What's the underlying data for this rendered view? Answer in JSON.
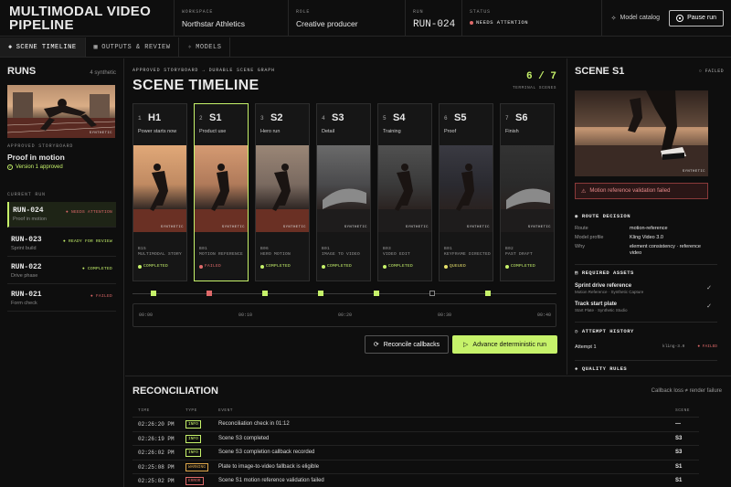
{
  "header": {
    "brand": "MULTIMODAL VIDEO PIPELINE",
    "workspace_label": "WORKSPACE",
    "workspace": "Northstar Athletics",
    "role_label": "ROLE",
    "role": "Creative producer",
    "run_label": "RUN",
    "run": "RUN-024",
    "status_label": "STATUS",
    "status": "NEEDS ATTENTION",
    "catalog": "Model catalog",
    "pause": "Pause run"
  },
  "tabs": [
    {
      "label": "SCENE TIMELINE",
      "icon": "layers-icon"
    },
    {
      "label": "OUTPUTS & REVIEW",
      "icon": "grid-icon"
    },
    {
      "label": "MODELS",
      "icon": "sparkle-icon"
    }
  ],
  "runs": {
    "title": "RUNS",
    "count": "4 synthetic",
    "thumb_tag": "SYNTHETIC",
    "storyboard_label": "APPROVED STORYBOARD",
    "storyboard_title": "Proof in motion",
    "storyboard_version": "Version 1 approved",
    "current_label": "CURRENT RUN",
    "items": [
      {
        "id": "RUN-024",
        "sub": "Proof in motion",
        "status": "NEEDS ATTENTION",
        "color": "#e06a6a"
      },
      {
        "id": "RUN-023",
        "sub": "Sprint build",
        "status": "READY FOR REVIEW",
        "color": "#c6f26a"
      },
      {
        "id": "RUN-022",
        "sub": "Drive phase",
        "status": "COMPLETED",
        "color": "#c6f26a"
      },
      {
        "id": "RUN-021",
        "sub": "Form check",
        "status": "FAILED",
        "color": "#e06a6a"
      }
    ]
  },
  "timeline": {
    "kicker": "APPROVED STORYBOARD → DURABLE SCENE GRAPH",
    "title": "SCENE TIMELINE",
    "count": "6 / 7",
    "count_label": "TERMINAL SCENES",
    "synthetic_tag": "SYNTHETIC",
    "scenes": [
      {
        "num": "1",
        "id": "H1",
        "name": "Power starts now",
        "code": "B15",
        "mode": "MULTIMODAL STORY",
        "status": "COMPLETED",
        "color": "#c6f26a"
      },
      {
        "num": "2",
        "id": "S1",
        "name": "Product use",
        "code": "B01",
        "mode": "MOTION REFERENCE",
        "status": "FAILED",
        "color": "#e06a6a"
      },
      {
        "num": "3",
        "id": "S2",
        "name": "Hero run",
        "code": "B06",
        "mode": "HERO MOTION",
        "status": "COMPLETED",
        "color": "#c6f26a"
      },
      {
        "num": "4",
        "id": "S3",
        "name": "Detail",
        "code": "B01",
        "mode": "IMAGE TO VIDEO",
        "status": "COMPLETED",
        "color": "#c6f26a"
      },
      {
        "num": "5",
        "id": "S4",
        "name": "Training",
        "code": "B03",
        "mode": "VIDEO EDIT",
        "status": "COMPLETED",
        "color": "#c6f26a"
      },
      {
        "num": "6",
        "id": "S5",
        "name": "Proof",
        "code": "B01",
        "mode": "KEYFRAME DIRECTED",
        "status": "QUEUED",
        "color": "#e6e06a"
      },
      {
        "num": "7",
        "id": "S6",
        "name": "Finish",
        "code": "B02",
        "mode": "PAST DRAFT",
        "status": "COMPLETED",
        "color": "#c6f26a"
      }
    ],
    "ticks": [
      "00:00",
      "00:10",
      "00:20",
      "00:30",
      "00:40"
    ],
    "reconcile": "Reconcile callbacks",
    "advance": "Advance deterministic run"
  },
  "detail": {
    "title": "SCENE S1",
    "status": "FAILED",
    "img_tag": "SYNTHETIC",
    "alert": "Motion reference validation failed",
    "route_title": "ROUTE DECISION",
    "route": [
      {
        "k": "Route",
        "v": "motion-reference"
      },
      {
        "k": "Model profile",
        "v": "Kling Video 3.0"
      },
      {
        "k": "Why",
        "v": "element consistency · reference video"
      }
    ],
    "assets_title": "REQUIRED ASSETS",
    "assets": [
      {
        "name": "Sprint drive reference",
        "sub": "Motion Reference · Synthetic Capture"
      },
      {
        "name": "Track start plate",
        "sub": "Start Plate · Synthetic Studio"
      }
    ],
    "attempt_title": "ATTEMPT HISTORY",
    "attempt": {
      "label": "Attempt 1",
      "model": "kling-3.0",
      "status": "FAILED"
    },
    "quality_title": "QUALITY RULES"
  },
  "reconciliation": {
    "title": "RECONCILIATION",
    "note": "Callback loss ≠ render failure",
    "headers": {
      "time": "TIME",
      "type": "TYPE",
      "event": "EVENT",
      "scene": "SCENE"
    },
    "rows": [
      {
        "time": "02:26:20 PM",
        "type": "INFO",
        "event": "Reconciliation check in 01:12",
        "scene": "—",
        "color": "#c6f26a"
      },
      {
        "time": "02:26:19 PM",
        "type": "INFO",
        "event": "Scene S3 completed",
        "scene": "S3",
        "color": "#c6f26a"
      },
      {
        "time": "02:26:02 PM",
        "type": "INFO",
        "event": "Scene S3 completion callback recorded",
        "scene": "S3",
        "color": "#c6f26a"
      },
      {
        "time": "02:25:08 PM",
        "type": "WARNING",
        "event": "Plate to image-to-video fallback is eligible",
        "scene": "S1",
        "color": "#e0a84a"
      },
      {
        "time": "02:25:02 PM",
        "type": "ERROR",
        "event": "Scene S1 motion reference validation failed",
        "scene": "S1",
        "color": "#e06a6a"
      }
    ]
  }
}
